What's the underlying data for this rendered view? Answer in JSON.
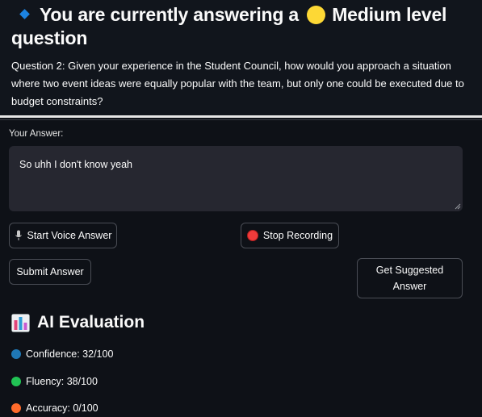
{
  "header": {
    "title_part1": "You are currently answering a",
    "title_part2": "Medium level question",
    "level_color": "#fdd835",
    "question_text": "Question 2: Given your experience in the Student Council, how would you approach a situation where two event ideas were equally popular with the team, but only one could be executed due to budget constraints?"
  },
  "answer": {
    "label": "Your Answer:",
    "value": "So uhh I don't know yeah"
  },
  "buttons": {
    "voice_label": "Start Voice Answer",
    "stop_label": "Stop Recording",
    "submit_label": "Submit Answer",
    "suggest_label": "Get Suggested Answer"
  },
  "evaluation": {
    "title": "AI Evaluation",
    "metrics": [
      {
        "label": "Confidence: 32/100",
        "color": "#1f77b4"
      },
      {
        "label": "Fluency: 38/100",
        "color": "#21c354"
      },
      {
        "label": "Accuracy: 0/100",
        "color": "#ff6b2b"
      }
    ]
  },
  "icons": {
    "diamond": "small-blue-diamond-icon",
    "level": "yellow-circle-icon",
    "mic": "microphone-icon",
    "record": "red-circle-icon",
    "chart": "bar-chart-icon"
  }
}
